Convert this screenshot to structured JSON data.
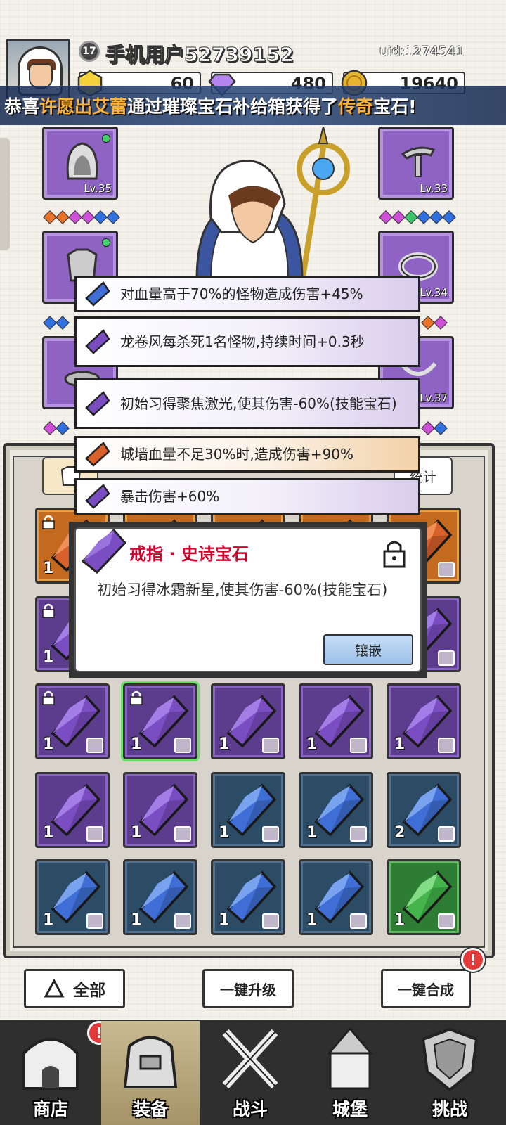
{
  "header": {
    "level": "17",
    "user_name": "手机用户52739152",
    "uid": "uid:1274541",
    "currencies": {
      "gold_tickets": "60",
      "gems": "480",
      "coins": "19640"
    }
  },
  "banner": {
    "part1": "恭喜",
    "player": "许愿出艾蕾",
    "part2": "通过璀璨宝石补给箱获得了",
    "rarity": "传奇",
    "part3": "宝石!"
  },
  "equipment": {
    "left": [
      {
        "name": "hood",
        "level": "Lv.35"
      },
      {
        "name": "armor",
        "level": ""
      },
      {
        "name": "boots",
        "level": ""
      }
    ],
    "right": [
      {
        "name": "staff",
        "level": "Lv.33"
      },
      {
        "name": "ring",
        "level": "Lv.34"
      },
      {
        "name": "amulet",
        "level": "Lv.37"
      }
    ]
  },
  "affixes": [
    {
      "text": "对血量高于70%的怪物造成伤害+45%",
      "gem": "blue"
    },
    {
      "text": "龙卷风每杀死1名怪物,持续时间+0.3秒",
      "gem": "purple"
    },
    {
      "text": "初始习得聚焦激光,使其伤害-60%(技能宝石)",
      "gem": "purple"
    },
    {
      "text": "城墙血量不足30%时,造成伤害+90%",
      "gem": "orange"
    },
    {
      "text": "暴击伤害+60%",
      "gem": "purple"
    }
  ],
  "detail": {
    "title": "戒指 · 史诗宝石",
    "description": "初始习得冰霜新星,使其伤害-60%(技能宝石)",
    "inlay_label": "镶嵌"
  },
  "stats_button": "统计",
  "inventory": {
    "rows": [
      [
        {
          "color": "orange",
          "count": "1",
          "locked": true
        },
        {
          "color": "orange",
          "count": "",
          "locked": false
        },
        {
          "color": "orange",
          "count": "",
          "locked": false
        },
        {
          "color": "orange",
          "count": "",
          "locked": false
        },
        {
          "color": "orange",
          "count": "",
          "locked": false
        }
      ],
      [
        {
          "color": "purple",
          "count": "1",
          "locked": true
        },
        {
          "color": "purple",
          "count": "",
          "locked": false
        },
        {
          "color": "purple",
          "count": "",
          "locked": false
        },
        {
          "color": "purple",
          "count": "",
          "locked": false
        },
        {
          "color": "purple",
          "count": "",
          "locked": false
        }
      ],
      [
        {
          "color": "purple",
          "count": "1",
          "locked": true
        },
        {
          "color": "purple",
          "count": "1",
          "locked": true,
          "selected": true
        },
        {
          "color": "purple",
          "count": "1",
          "locked": false
        },
        {
          "color": "purple",
          "count": "1",
          "locked": false
        },
        {
          "color": "purple",
          "count": "1",
          "locked": false
        }
      ],
      [
        {
          "color": "purple",
          "count": "1",
          "locked": false
        },
        {
          "color": "purple",
          "count": "1",
          "locked": false
        },
        {
          "color": "blue",
          "count": "1",
          "locked": false
        },
        {
          "color": "blue",
          "count": "1",
          "locked": false
        },
        {
          "color": "blue",
          "count": "2",
          "locked": false
        }
      ],
      [
        {
          "color": "blue",
          "count": "1",
          "locked": false
        },
        {
          "color": "blue",
          "count": "1",
          "locked": false
        },
        {
          "color": "blue",
          "count": "1",
          "locked": false
        },
        {
          "color": "blue",
          "count": "1",
          "locked": false
        },
        {
          "color": "green",
          "count": "1",
          "locked": false
        }
      ]
    ]
  },
  "bottom_buttons": {
    "all": "全部",
    "upgrade": "一键升级",
    "merge": "一键合成"
  },
  "alert_mark": "!",
  "nav": [
    {
      "label": "商店",
      "icon": "shop-icon"
    },
    {
      "label": "装备",
      "icon": "equipment-bag-icon"
    },
    {
      "label": "战斗",
      "icon": "crossed-swords-icon"
    },
    {
      "label": "城堡",
      "icon": "castle-icon"
    },
    {
      "label": "挑战",
      "icon": "shield-icon"
    }
  ],
  "colors": {
    "purple_gem": "#7a4ec2",
    "blue_gem": "#3f6fd6",
    "orange_gem": "#d8602a",
    "green_gem": "#43b54a",
    "epic_title": "#d0002d",
    "banner_highlight": "#ffb23a"
  }
}
